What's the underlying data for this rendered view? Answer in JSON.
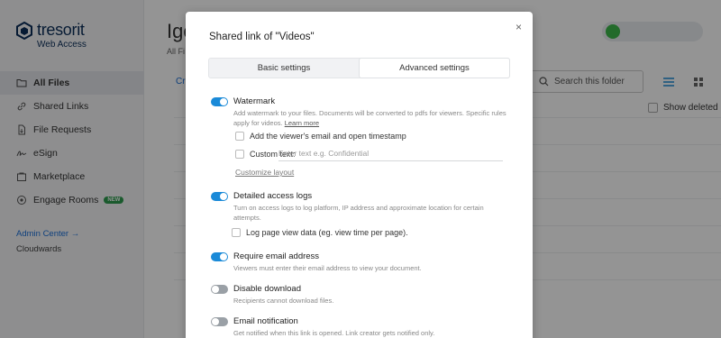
{
  "app": {
    "logo_name": "tresorit",
    "logo_sub": "Web Access",
    "nav": [
      {
        "label": "All Files",
        "icon": "folder-icon",
        "active": true
      },
      {
        "label": "Shared Links",
        "icon": "link-icon"
      },
      {
        "label": "File Requests",
        "icon": "file-request-icon"
      },
      {
        "label": "eSign",
        "icon": "signature-icon"
      },
      {
        "label": "Marketplace",
        "icon": "marketplace-icon"
      },
      {
        "label": "Engage Rooms",
        "icon": "engage-icon",
        "badge": "NEW"
      }
    ],
    "admin_center": "Admin Center →",
    "company": "Cloudwards",
    "main_title": "Igo",
    "main_crumb": "All Fi",
    "create_link": "Cr",
    "search_placeholder": "Search this folder",
    "show_deleted": "Show deleted"
  },
  "modal": {
    "title": "Shared link of \"Videos\"",
    "close": "×",
    "tabs": [
      {
        "label": "Basic settings",
        "active": false
      },
      {
        "label": "Advanced settings",
        "active": true
      }
    ],
    "settings": {
      "watermark": {
        "label": "Watermark",
        "on": true,
        "desc": "Add watermark to your files. Documents will be converted to pdfs for viewers. Specific rules apply for videos.",
        "link": "Learn more",
        "option_email": "Add the viewer's email and open timestamp",
        "option_custom": "Custom text:",
        "custom_placeholder": "Enter text e.g. Confidential",
        "customize": "Customize layout"
      },
      "access_logs": {
        "label": "Detailed access logs",
        "on": true,
        "desc": "Turn on access logs to log platform, IP address and approximate location for certain attempts.",
        "option_page": "Log page view data (eg. view time per page)."
      },
      "require_email": {
        "label": "Require email address",
        "on": true,
        "desc": "Viewers must enter their email address to view your document."
      },
      "disable_download": {
        "label": "Disable download",
        "on": false,
        "desc": "Recipients cannot download files."
      },
      "email_notification": {
        "label": "Email notification",
        "on": false,
        "desc": "Get notified when this link is opened. Link creator gets notified only."
      }
    }
  },
  "colors": {
    "toggle_on": "#1a8ad8",
    "toggle_off": "#9aa0a6",
    "brand": "#0b2e59",
    "link": "#1a6fd8"
  }
}
